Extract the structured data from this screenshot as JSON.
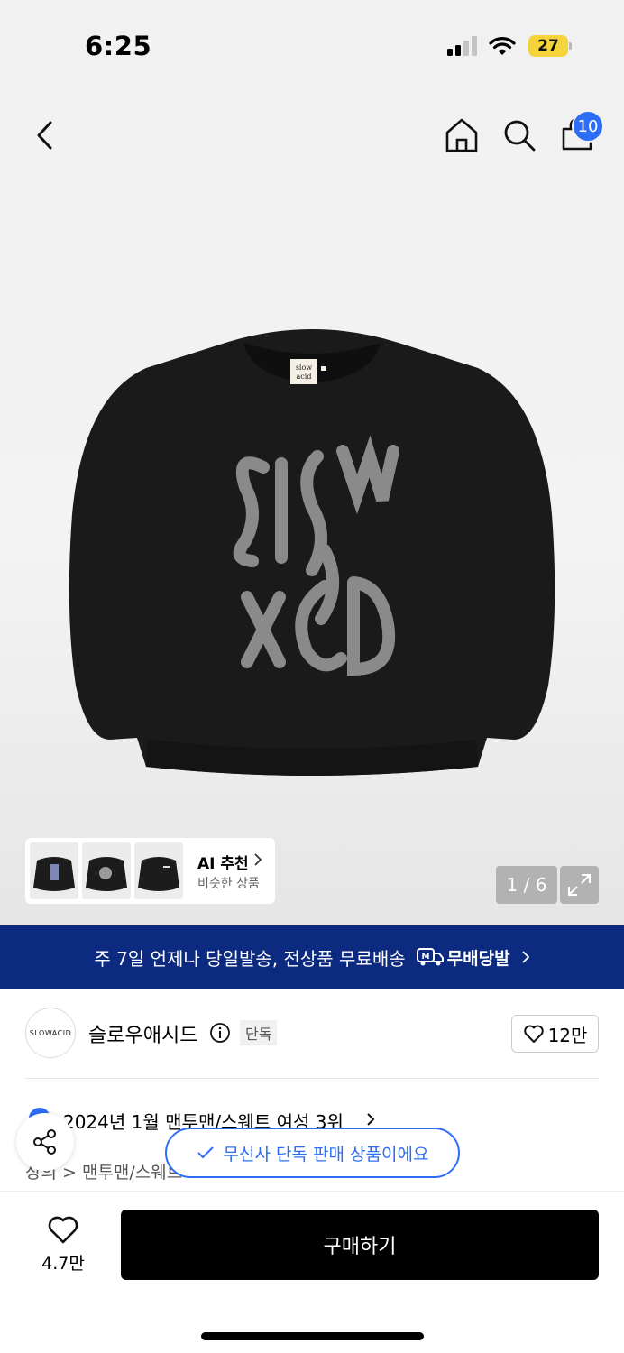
{
  "status_bar": {
    "time": "6:25",
    "battery": "27",
    "signal_icon": "cellular-signal-icon",
    "wifi_icon": "wifi-icon"
  },
  "nav": {
    "cart_count": "10"
  },
  "product_image": {
    "collar_label_line1": "slow",
    "collar_label_line2": "acid"
  },
  "ai_recommend": {
    "title": "AI 추천",
    "subtitle": "비슷한 상품"
  },
  "image_counter": "1 / 6",
  "banner": {
    "text": "주 7일 언제나 당일발송, 전상품 무료배송",
    "logo_letter": "M",
    "logo_text": "무배당발"
  },
  "brand": {
    "logo_text": "SLOWACID",
    "name": "슬로우애시드",
    "tag": "단독",
    "likes": "12만"
  },
  "ranking": {
    "text": "2024년 1월 맨투맨/스웨트 여성 3위"
  },
  "category": {
    "text": "상의 > 맨투맨/스웨트"
  },
  "toast": {
    "text": "무신사 단독 판매 상품이에요"
  },
  "bottom": {
    "wish_count": "4.7만",
    "buy_label": "구매하기"
  },
  "colors": {
    "accent_blue": "#2e6df6",
    "banner_navy": "#0b2a80",
    "battery_yellow": "#f5d33b"
  }
}
